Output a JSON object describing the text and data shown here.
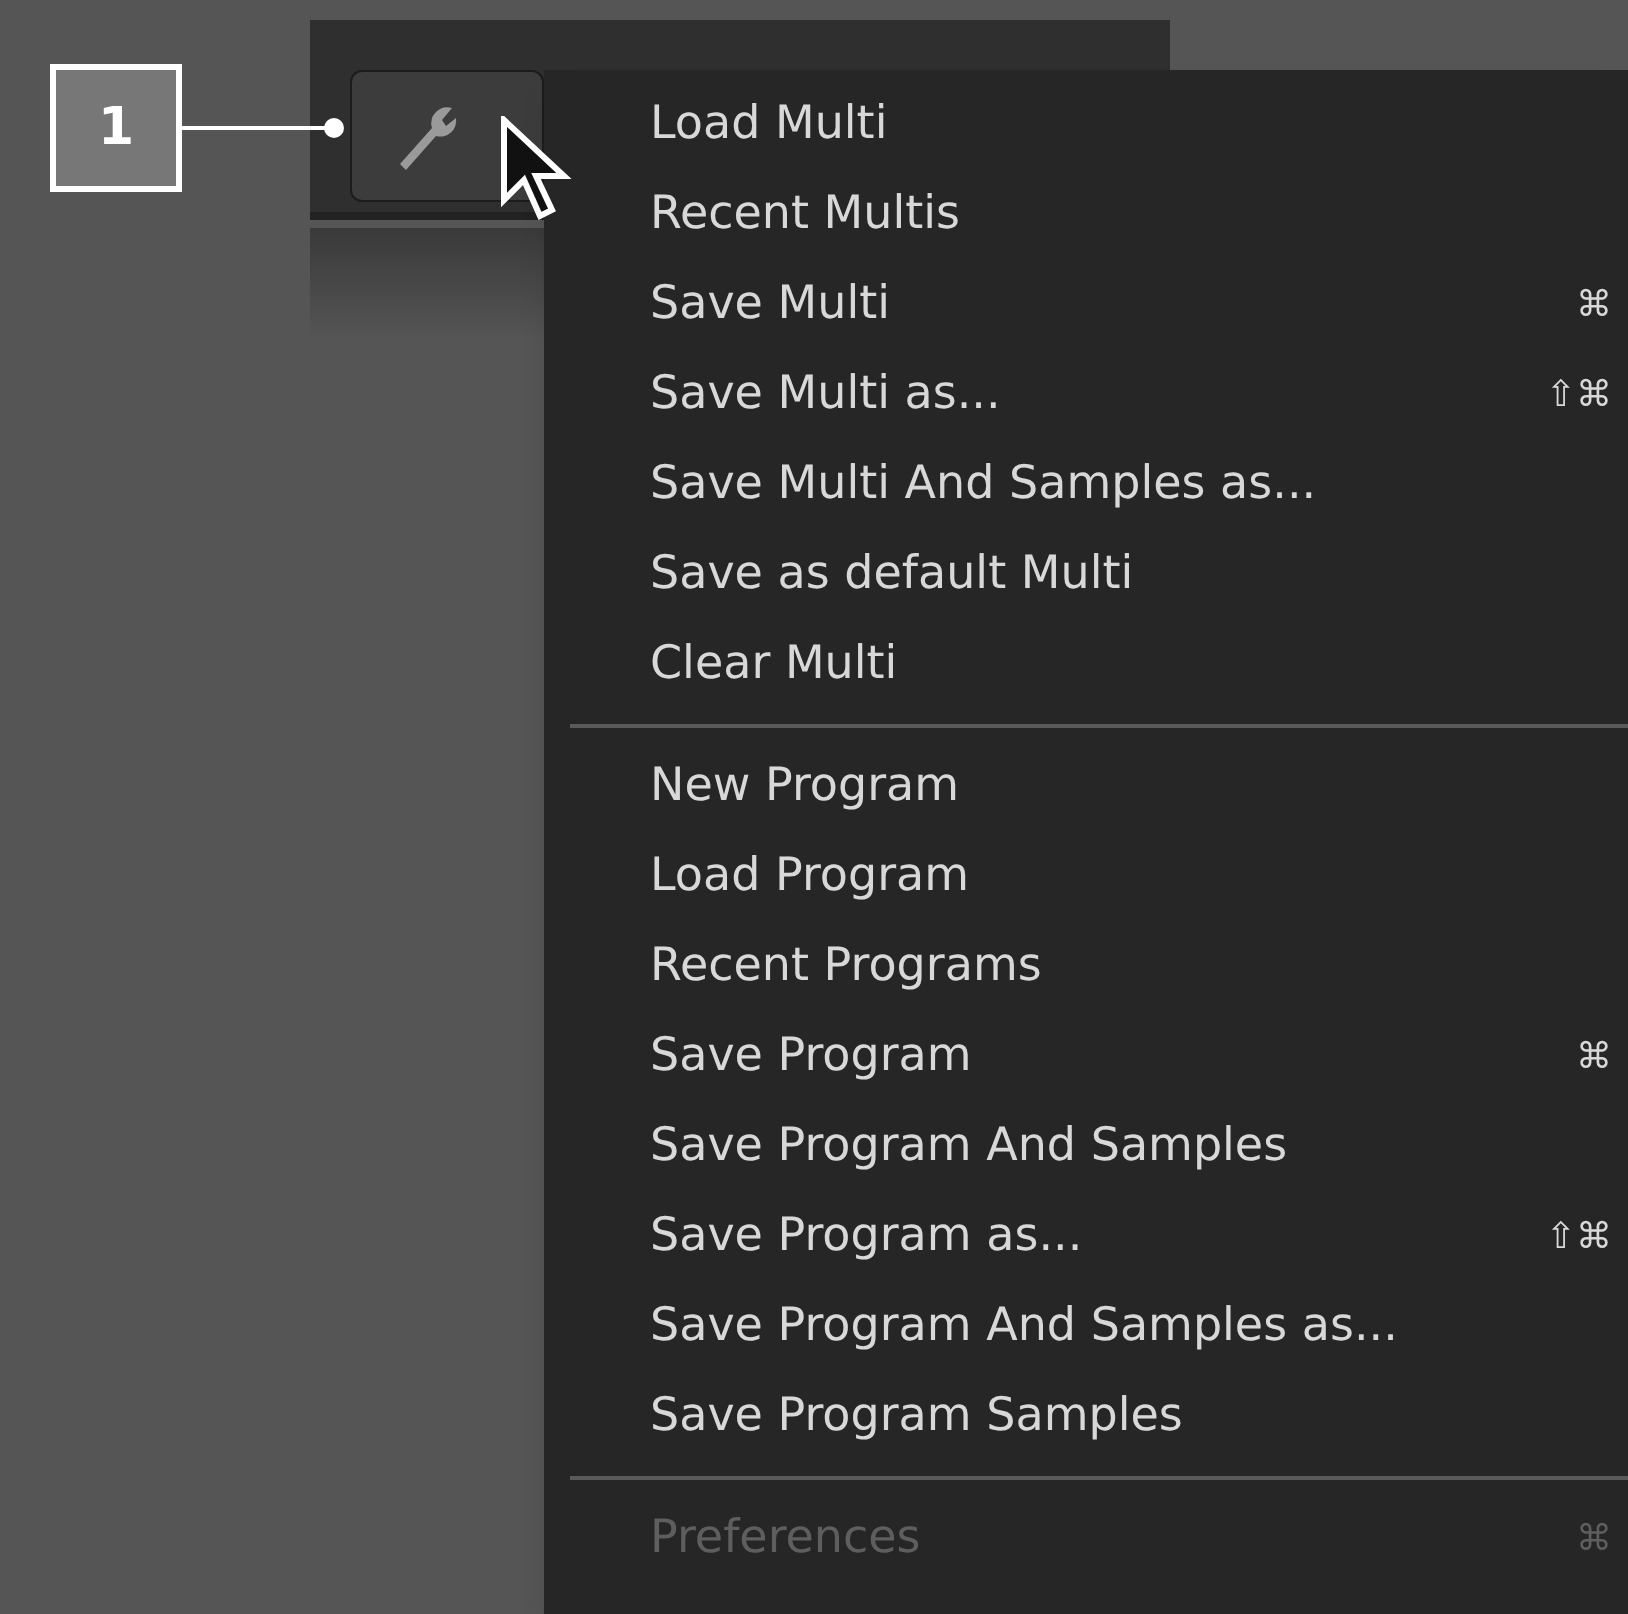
{
  "callout": {
    "label": "1"
  },
  "menu": {
    "groups": [
      [
        {
          "label": "Load Multi",
          "disabled": false
        },
        {
          "label": "Recent Multis",
          "disabled": false
        },
        {
          "label": "Save Multi",
          "shortcut": "⌘",
          "disabled": false
        },
        {
          "label": "Save Multi as...",
          "shortcut": "⇧⌘",
          "disabled": false
        },
        {
          "label": "Save Multi And Samples as...",
          "disabled": false
        },
        {
          "label": "Save as default Multi",
          "disabled": false
        },
        {
          "label": "Clear Multi",
          "disabled": false
        }
      ],
      [
        {
          "label": "New Program",
          "disabled": false
        },
        {
          "label": "Load Program",
          "disabled": false
        },
        {
          "label": "Recent Programs",
          "disabled": false
        },
        {
          "label": "Save Program",
          "shortcut": "⌘",
          "disabled": false
        },
        {
          "label": "Save Program And Samples",
          "disabled": false
        },
        {
          "label": "Save Program as...",
          "shortcut": "⇧⌘",
          "disabled": false
        },
        {
          "label": "Save Program And Samples as...",
          "disabled": false
        },
        {
          "label": "Save Program Samples",
          "disabled": false
        }
      ],
      [
        {
          "label": "Preferences",
          "shortcut": "⌘",
          "disabled": true
        }
      ]
    ]
  }
}
